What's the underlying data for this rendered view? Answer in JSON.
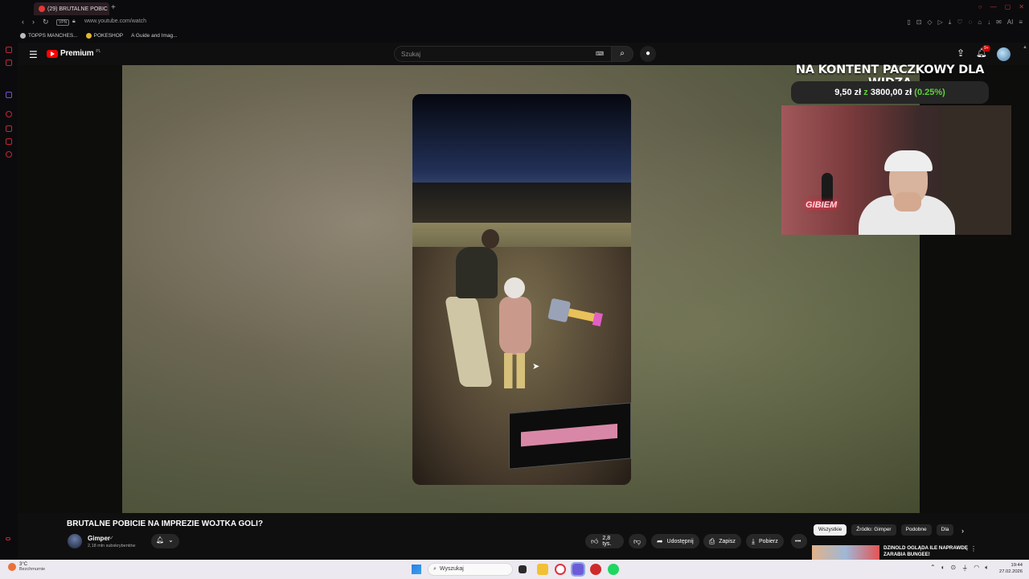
{
  "browser": {
    "tab_title": "(29) BRUTALNE POBIC",
    "new_tab": "+",
    "url": "www.youtube.com/watch",
    "vpn_label": "VPN",
    "bookmarks": [
      "TOPPS MANCHES...",
      "POKESHOP",
      "A Guide and Imag..."
    ],
    "ext_ai_label": "AI"
  },
  "youtube": {
    "logo_text": "Premium",
    "logo_region": "PL",
    "search_placeholder": "Szukaj",
    "notification_count": "9+"
  },
  "overlay": {
    "title": "NA KONTENT PACZKOWY DLA WIDZA",
    "goal_current": "9,50 zł",
    "goal_connector": "z",
    "goal_target": "3800,00 zł",
    "goal_percent": "(0.25%)",
    "neon_sign": "GIBIEM"
  },
  "video": {
    "title": "BRUTALNE POBICIE NA IMPREZIE WOJTKA GOLI?",
    "channel": "Gimper",
    "verified": "✓",
    "subscribers": "2,18 mln subskrybentów",
    "likes": "2,8 tys.",
    "share": "Udostępnij",
    "save": "Zapisz",
    "download": "Pobierz"
  },
  "chips": [
    "Wszystkie",
    "Źródło: Gimper",
    "Podobne",
    "Dla"
  ],
  "recommendation": {
    "title": "DZINOLD OGLĄDA ILE NAPRAWDĘ ZARABIA BUNGEE!"
  },
  "taskbar": {
    "temperature": "3°C",
    "weather": "Bezchmurnie",
    "search_placeholder": "Wyszukaj",
    "time": "19:44",
    "date": "27.02.2026"
  },
  "colors": {
    "youtube_red": "#ff0000",
    "goal_green": "#5ed23a",
    "neon_red": "#ff2b48"
  }
}
